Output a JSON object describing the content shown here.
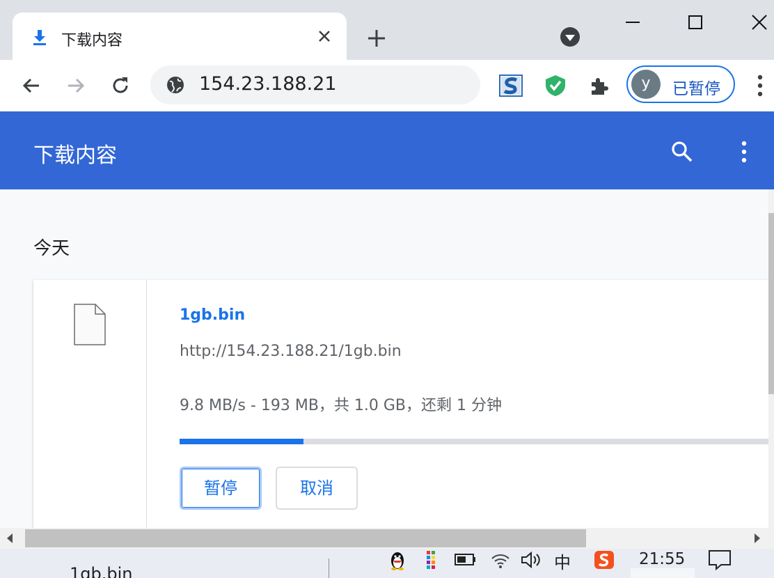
{
  "tab": {
    "title": "下载内容",
    "icon": "download-icon"
  },
  "address": {
    "url": "154.23.188.21"
  },
  "profile": {
    "initial": "y",
    "status": "已暂停"
  },
  "page": {
    "header_title": "下载内容",
    "date_group": "今天",
    "download": {
      "filename": "1gb.bin",
      "url": "http://154.23.188.21/1gb.bin",
      "status": "9.8 MB/s - 193 MB，共 1.0 GB，还剩 1 分钟",
      "progress_fraction": 0.21,
      "pause_label": "暂停",
      "cancel_label": "取消"
    }
  },
  "taskbar": {
    "item_label": "1gb.bin",
    "ime_label": "中",
    "clock": "21:55"
  },
  "colors": {
    "accent": "#1a73e8",
    "header_bg": "#3367d6",
    "tab_strip": "#dee1e6"
  }
}
